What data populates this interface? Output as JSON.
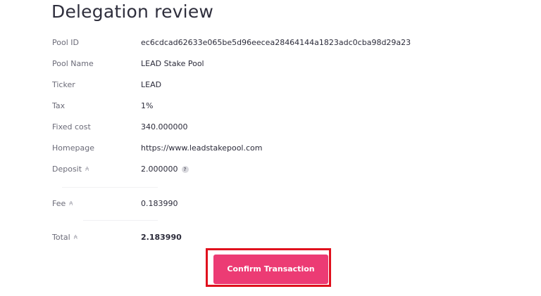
{
  "page": {
    "title": "Delegation review"
  },
  "details": {
    "pool_id": {
      "label": "Pool ID",
      "value": "ec6cdcad62633e065be5d96eecea28464144a1823adc0cba98d29a23"
    },
    "pool_name": {
      "label": "Pool Name",
      "value": "LEAD Stake Pool"
    },
    "ticker": {
      "label": "Ticker",
      "value": "LEAD"
    },
    "tax": {
      "label": "Tax",
      "value": "1%"
    },
    "fixed_cost": {
      "label": "Fixed cost",
      "value": "340.000000"
    },
    "homepage": {
      "label": "Homepage",
      "value": "https://www.leadstakepool.com"
    },
    "deposit": {
      "label": "Deposit",
      "value": "2.000000",
      "help_glyph": "?"
    },
    "fee": {
      "label": "Fee",
      "value": "0.183990"
    },
    "total": {
      "label": "Total",
      "value": "2.183990"
    }
  },
  "currency": {
    "symbol": "₳",
    "icon": "ada-icon"
  },
  "actions": {
    "confirm_label": "Confirm Transaction"
  },
  "colors": {
    "accent": "#ec3b74",
    "highlight_border": "#e0101d"
  }
}
